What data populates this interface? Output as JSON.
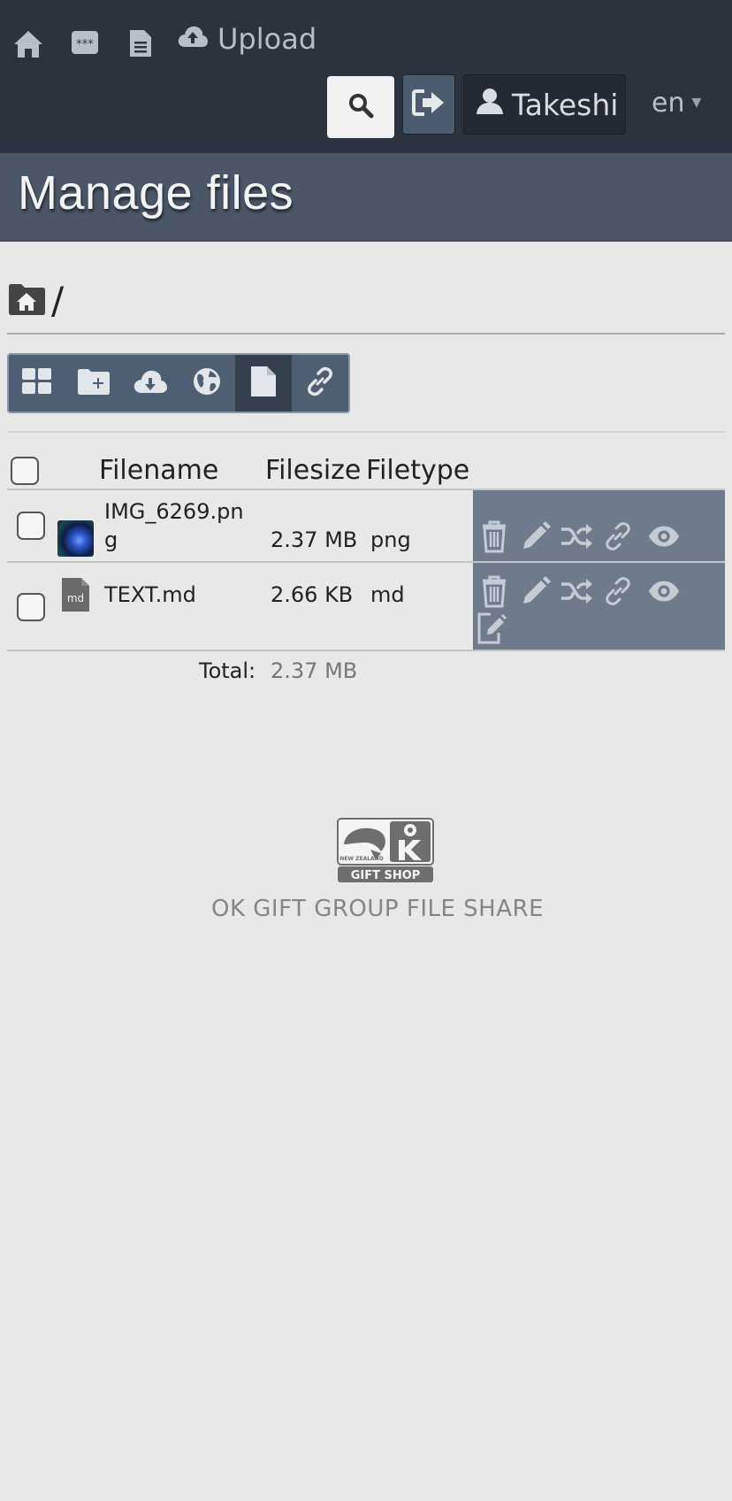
{
  "nav": {
    "upload_label": "Upload",
    "user_name": "Takeshi",
    "language": "en",
    "icons": [
      "home-icon",
      "password-icon",
      "document-icon",
      "cloud-upload-icon",
      "search-icon",
      "logout-icon",
      "user-icon"
    ]
  },
  "page": {
    "title": "Manage files"
  },
  "breadcrumb": {
    "separator": "/"
  },
  "toolbar": {
    "buttons": [
      "grid-view-icon",
      "new-folder-icon",
      "cloud-download-icon",
      "globe-icon",
      "file-icon",
      "link-icon"
    ],
    "active_index": 4
  },
  "table": {
    "headers": {
      "filename": "Filename",
      "filesize": "Filesize",
      "filetype": "Filetype"
    },
    "rows": [
      {
        "name_line1": "IMG_6269.pn",
        "name_line2": "g",
        "size": "2.37 MB",
        "type": "png"
      },
      {
        "name": "TEXT.md",
        "thumb_label": "md",
        "size": "2.66 KB",
        "type": "md"
      }
    ],
    "actions": [
      "trash-icon",
      "pencil-icon",
      "shuffle-icon",
      "link-icon",
      "eye-icon",
      "edit-file-icon"
    ]
  },
  "total": {
    "label": "Total:",
    "value": "2.37 MB"
  },
  "footer": {
    "logo_text": "NEW ZEALAND OK GIFT SHOP",
    "text": "OK GIFT GROUP FILE SHARE"
  },
  "colors": {
    "nav_bg": "#2c333e",
    "header_bg": "#4b5768",
    "toolbar_bg": "#4f5f73",
    "actions_bg": "#6d7b8d",
    "page_bg": "#e8e8e8"
  }
}
